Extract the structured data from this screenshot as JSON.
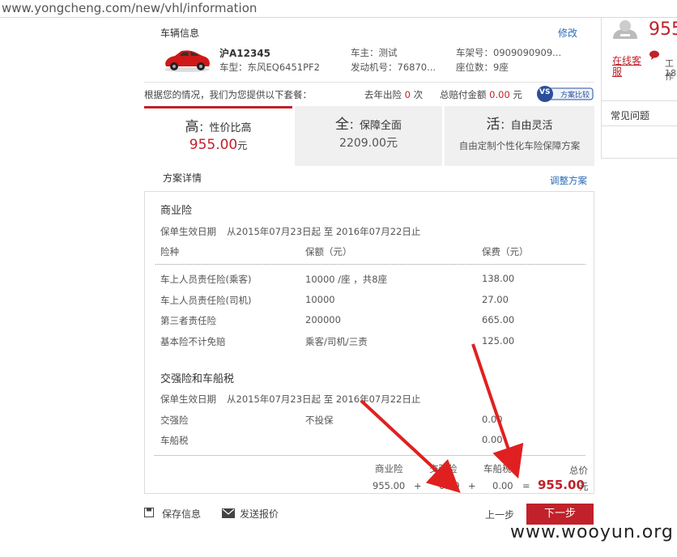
{
  "browser": {
    "url": "www.yongcheng.com/new/vhl/information"
  },
  "vehicle": {
    "section_title": "车辆信息",
    "edit_label": "修改",
    "plate": "沪A12345",
    "model": "车型：东风EQ6451PF2",
    "owner": "车主：测试",
    "engine": "发动机号：76870...",
    "frame": "车架号：0909090909...",
    "seats": "座位数：9座"
  },
  "summary": {
    "intro": "根据您的情况，我们为您提供以下套餐：",
    "claims_label": "去年出险",
    "claims_count": "0",
    "claims_unit": "次",
    "amount_label": "总赔付金额",
    "amount_value": "0.00",
    "amount_unit": "元",
    "compare_vs": "VS",
    "compare_label": "方案比较"
  },
  "plans": [
    {
      "char": "高",
      "sep": "：",
      "title": "性价比高",
      "price": "955.00",
      "unit": "元"
    },
    {
      "char": "全",
      "sep": "：",
      "title": "保障全面",
      "price": "2209.00",
      "unit": "元"
    },
    {
      "char": "活",
      "sep": "：",
      "title": "自由灵活",
      "desc": "自由定制个性化车险保障方案"
    }
  ],
  "details": {
    "title": "方案详情",
    "adjust_label": "调整方案",
    "commercial": {
      "title": "商业险",
      "period_label": "保单生效日期",
      "period": "从2015年07月23日起 至 2016年07月22日止",
      "headers": [
        "险种",
        "保额（元）",
        "保费（元）"
      ],
      "rows": [
        [
          "车上人员责任险(乘客)",
          "10000 /座 ，共8座",
          "138.00"
        ],
        [
          "车上人员责任险(司机)",
          "10000",
          "27.00"
        ],
        [
          "第三者责任险",
          "200000",
          "665.00"
        ],
        [
          "基本险不计免赔",
          "乘客/司机/三责",
          "125.00"
        ]
      ]
    },
    "compulsory": {
      "title": "交强险和车船税",
      "period_label": "保单生效日期",
      "period": "从2015年07月23日起 至 2016年07月22日止",
      "rows": [
        [
          "交强险",
          "不投保",
          "0.00"
        ],
        [
          "车船税",
          "",
          "0.00"
        ]
      ]
    },
    "totals": {
      "commercial_label": "商业险",
      "compulsory_label": "交强险",
      "tax_label": "车船税",
      "total_label": "总价",
      "commercial_value": "955.00",
      "compulsory_value": "0.00",
      "tax_value": "0.00",
      "plus": "+",
      "equals": "=",
      "total_value": "955.00",
      "total_unit": "元"
    }
  },
  "actions": {
    "save": "保存信息",
    "send": "发送报价",
    "prev": "上一步",
    "next": "下一步"
  },
  "sidebar": {
    "price": "955",
    "online_service": "在线客服",
    "work_hint": "工作",
    "time_hint": "18:",
    "faq": "常见问题"
  },
  "watermark": "www.wooyun.org",
  "colors": {
    "accent": "#c0212a",
    "link": "#2a6db6"
  },
  "icons": [
    "car-image",
    "vs-compare-icon",
    "save-icon",
    "mail-icon",
    "support-icon",
    "chat-icon",
    "arrow-annotation"
  ]
}
